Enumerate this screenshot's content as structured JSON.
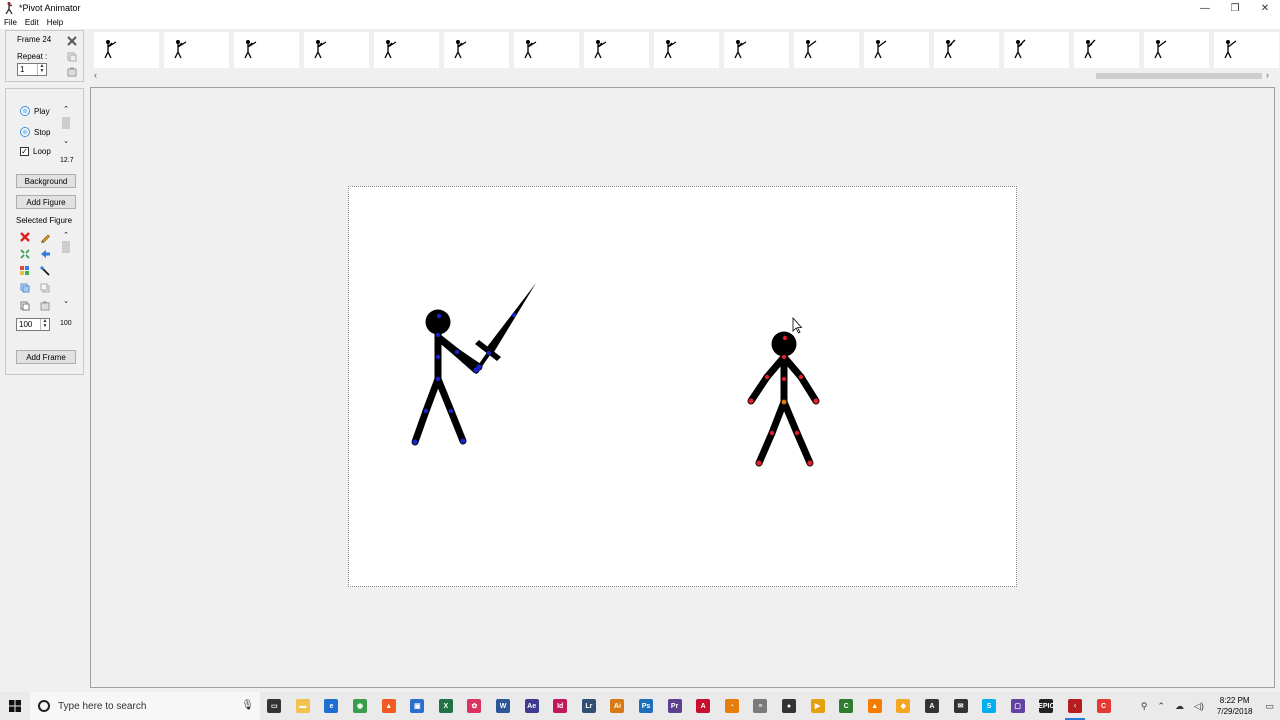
{
  "window": {
    "title": "*Pivot Animator",
    "minimize": "—",
    "restore": "❐",
    "close": "✕"
  },
  "menu": [
    "File",
    "Edit",
    "Help"
  ],
  "frame_panel": {
    "frame_label": "Frame 24",
    "repeat_label": "Repeat :",
    "repeat_value": "1"
  },
  "filmstrip": {
    "thumbnail_count": 17
  },
  "controls": {
    "play_label": "Play",
    "stop_label": "Stop",
    "loop_label": "Loop",
    "loop_checked": true,
    "speed_value": "12.7",
    "background_button": "Background",
    "add_figure_button": "Add Figure",
    "selected_figure_label": "Selected Figure",
    "scale_value": "100",
    "scale_readout": "100",
    "add_frame_button": "Add Frame"
  },
  "figures": [
    {
      "name": "stickman-with-sword",
      "joint_color": "#1a22cc"
    },
    {
      "name": "stickman-standing",
      "joint_color": "#e0202a",
      "center_joint_color": "#e07a10"
    }
  ],
  "taskbar": {
    "search_placeholder": "Type here to search",
    "apps": [
      {
        "name": "task-view",
        "color": "#333333",
        "glyph": "▭"
      },
      {
        "name": "file-explorer",
        "color": "#f2c14e",
        "glyph": "▬"
      },
      {
        "name": "edge",
        "color": "#1e6fd1",
        "glyph": "e"
      },
      {
        "name": "chrome",
        "color": "#3a9d4c",
        "glyph": "◉"
      },
      {
        "name": "brave",
        "color": "#f25a22",
        "glyph": "▲"
      },
      {
        "name": "store",
        "color": "#2b6fce",
        "glyph": "▣"
      },
      {
        "name": "excel",
        "color": "#217346",
        "glyph": "X"
      },
      {
        "name": "davinci",
        "color": "#d8345f",
        "glyph": "✿"
      },
      {
        "name": "word",
        "color": "#2b5797",
        "glyph": "W"
      },
      {
        "name": "after-effects",
        "color": "#3d3a8f",
        "glyph": "Ae"
      },
      {
        "name": "indesign",
        "color": "#c2185b",
        "glyph": "Id"
      },
      {
        "name": "lightroom",
        "color": "#314f74",
        "glyph": "Lr"
      },
      {
        "name": "illustrator",
        "color": "#d77a16",
        "glyph": "Ai"
      },
      {
        "name": "photoshop",
        "color": "#1c6fb8",
        "glyph": "Ps"
      },
      {
        "name": "premiere",
        "color": "#5c3f8f",
        "glyph": "Pr"
      },
      {
        "name": "acrobat",
        "color": "#c8102e",
        "glyph": "A"
      },
      {
        "name": "blender",
        "color": "#e87d0d",
        "glyph": "◔"
      },
      {
        "name": "notepad",
        "color": "#7a7a7a",
        "glyph": "≡"
      },
      {
        "name": "obs",
        "color": "#333333",
        "glyph": "●"
      },
      {
        "name": "plex",
        "color": "#e5a00d",
        "glyph": "▶"
      },
      {
        "name": "camtasia",
        "color": "#2e7d32",
        "glyph": "C"
      },
      {
        "name": "vlc",
        "color": "#f57c00",
        "glyph": "▲"
      },
      {
        "name": "cheese",
        "color": "#f5a623",
        "glyph": "◆"
      },
      {
        "name": "inkscape",
        "color": "#333333",
        "glyph": "A"
      },
      {
        "name": "mail",
        "color": "#333333",
        "glyph": "✉"
      },
      {
        "name": "skype",
        "color": "#00aff0",
        "glyph": "S"
      },
      {
        "name": "twitch",
        "color": "#6441a5",
        "glyph": "▢"
      },
      {
        "name": "epic",
        "color": "#222222",
        "glyph": "EPIC"
      },
      {
        "name": "pivot-animator",
        "color": "#b51e1e",
        "glyph": "ᚲ",
        "active": true
      },
      {
        "name": "camtasia-recorder",
        "color": "#e53935",
        "glyph": "C"
      }
    ],
    "tray": {
      "time": "8:22 PM",
      "date": "7/29/2018"
    }
  }
}
